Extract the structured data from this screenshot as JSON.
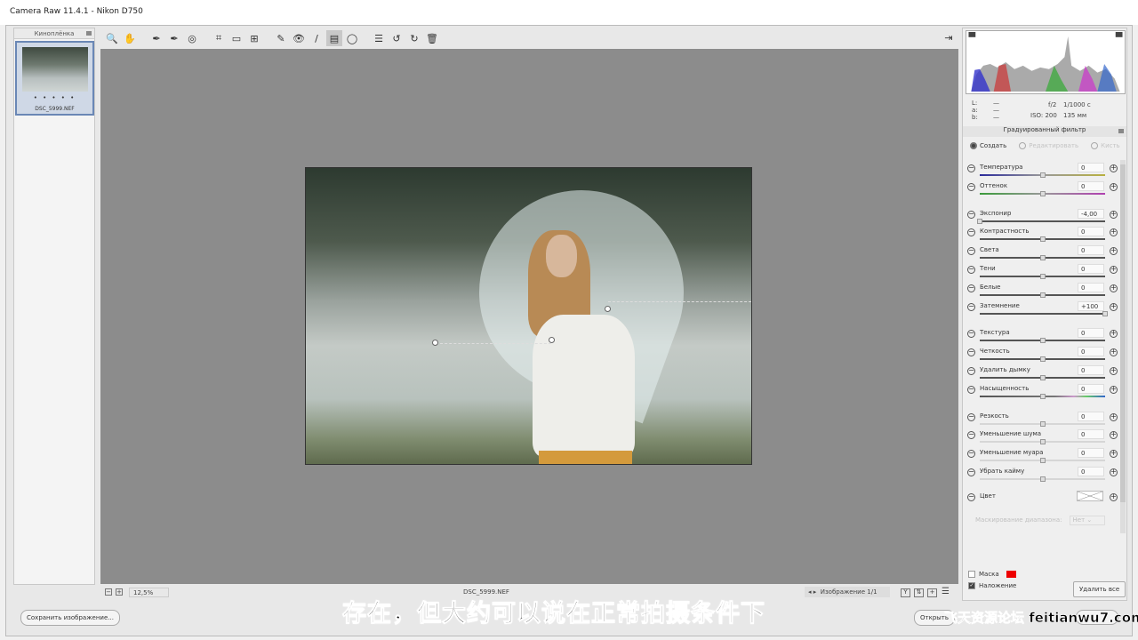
{
  "window": {
    "title": "Camera Raw 11.4.1  -  Nikon D750"
  },
  "filmstrip": {
    "title": "Киноплёнка",
    "items": [
      {
        "name": "DSC_5999.NEF",
        "rating_dots": "• • • • •"
      }
    ]
  },
  "toolbar": {
    "tools": [
      {
        "name": "zoom-icon",
        "glyph": "🔍"
      },
      {
        "name": "hand-icon",
        "glyph": "✋"
      },
      {
        "sep": true
      },
      {
        "name": "white-balance-icon",
        "glyph": "✒"
      },
      {
        "name": "color-sampler-icon",
        "glyph": "✒"
      },
      {
        "name": "targeted-adjustment-icon",
        "glyph": "◎"
      },
      {
        "sep": true
      },
      {
        "name": "crop-icon",
        "glyph": "⌗"
      },
      {
        "name": "straighten-icon",
        "glyph": "▭"
      },
      {
        "name": "transform-icon",
        "glyph": "⊞"
      },
      {
        "sep": true
      },
      {
        "name": "spot-removal-icon",
        "glyph": "✎"
      },
      {
        "name": "red-eye-icon",
        "glyph": "👁"
      },
      {
        "name": "adjustment-brush-icon",
        "glyph": "/"
      },
      {
        "name": "graduated-filter-icon",
        "glyph": "▤",
        "active": true
      },
      {
        "name": "radial-filter-icon",
        "glyph": "◯"
      },
      {
        "sep": true
      },
      {
        "name": "preferences-icon",
        "glyph": "☰"
      },
      {
        "name": "rotate-left-icon",
        "glyph": "↺"
      },
      {
        "name": "rotate-right-icon",
        "glyph": "↻"
      },
      {
        "name": "trash-icon",
        "glyph": "🗑"
      }
    ],
    "fullscreen_glyph": "⇥"
  },
  "status": {
    "zoom": "12,5%",
    "filename": "DSC_5999.NEF",
    "image_counter": "Изображение 1/1"
  },
  "info": {
    "L": "L:",
    "a": "a:",
    "b": "b:",
    "dash": "—",
    "aperture": "f/2",
    "shutter": "1/1000 с",
    "iso": "ISO: 200",
    "focal": "135 мм"
  },
  "panel": {
    "title": "Градуированный фильтр",
    "modes": [
      {
        "label": "Создать",
        "selected": true
      },
      {
        "label": "Редактировать",
        "disabled": true
      },
      {
        "label": "Кисть",
        "disabled": true
      }
    ],
    "sliders": [
      {
        "label": "Температура",
        "value": "0",
        "pos": 0.5,
        "group": 0,
        "track": "temp"
      },
      {
        "label": "Оттенок",
        "value": "0",
        "pos": 0.5,
        "group": 0,
        "track": "tint"
      },
      {
        "label": "Экспонир",
        "value": "-4,00",
        "pos": 0.0,
        "group": 1
      },
      {
        "label": "Контрастность",
        "value": "0",
        "pos": 0.5,
        "group": 1
      },
      {
        "label": "Света",
        "value": "0",
        "pos": 0.5,
        "group": 1
      },
      {
        "label": "Тени",
        "value": "0",
        "pos": 0.5,
        "group": 1
      },
      {
        "label": "Белые",
        "value": "0",
        "pos": 0.5,
        "group": 1
      },
      {
        "label": "Затемнение",
        "value": "+100",
        "pos": 1.0,
        "group": 1
      },
      {
        "label": "Текстура",
        "value": "0",
        "pos": 0.5,
        "group": 2
      },
      {
        "label": "Четкость",
        "value": "0",
        "pos": 0.5,
        "group": 2
      },
      {
        "label": "Удалить дымку",
        "value": "0",
        "pos": 0.5,
        "group": 2
      },
      {
        "label": "Насыщенность",
        "value": "0",
        "pos": 0.5,
        "group": 2,
        "track": "sat"
      },
      {
        "label": "Резкость",
        "value": "0",
        "pos": 0.5,
        "group": 3,
        "track": "light"
      },
      {
        "label": "Уменьшение шума",
        "value": "0",
        "pos": 0.5,
        "group": 3,
        "track": "light"
      },
      {
        "label": "Уменьшение муара",
        "value": "0",
        "pos": 0.5,
        "group": 3,
        "track": "light"
      },
      {
        "label": "Убрать кайму",
        "value": "0",
        "pos": 0.5,
        "group": 3,
        "track": "light"
      }
    ],
    "color_label": "Цвет",
    "range_mask_label": "Маскирование диапазона:",
    "range_mask_value": "Нет",
    "mask_label": "Маска",
    "mask_checked": false,
    "mask_color": "#e00000",
    "overlay_label": "Наложение",
    "overlay_checked": true,
    "clear_all": "Удалить все"
  },
  "footer": {
    "save": "Сохранить изображение...",
    "open": "Открыть"
  },
  "overlay": {
    "subtitle": "存在，但大约可以说在正常拍摄条件下",
    "watermark": "飞天资源论坛 feitianwu7.com"
  }
}
